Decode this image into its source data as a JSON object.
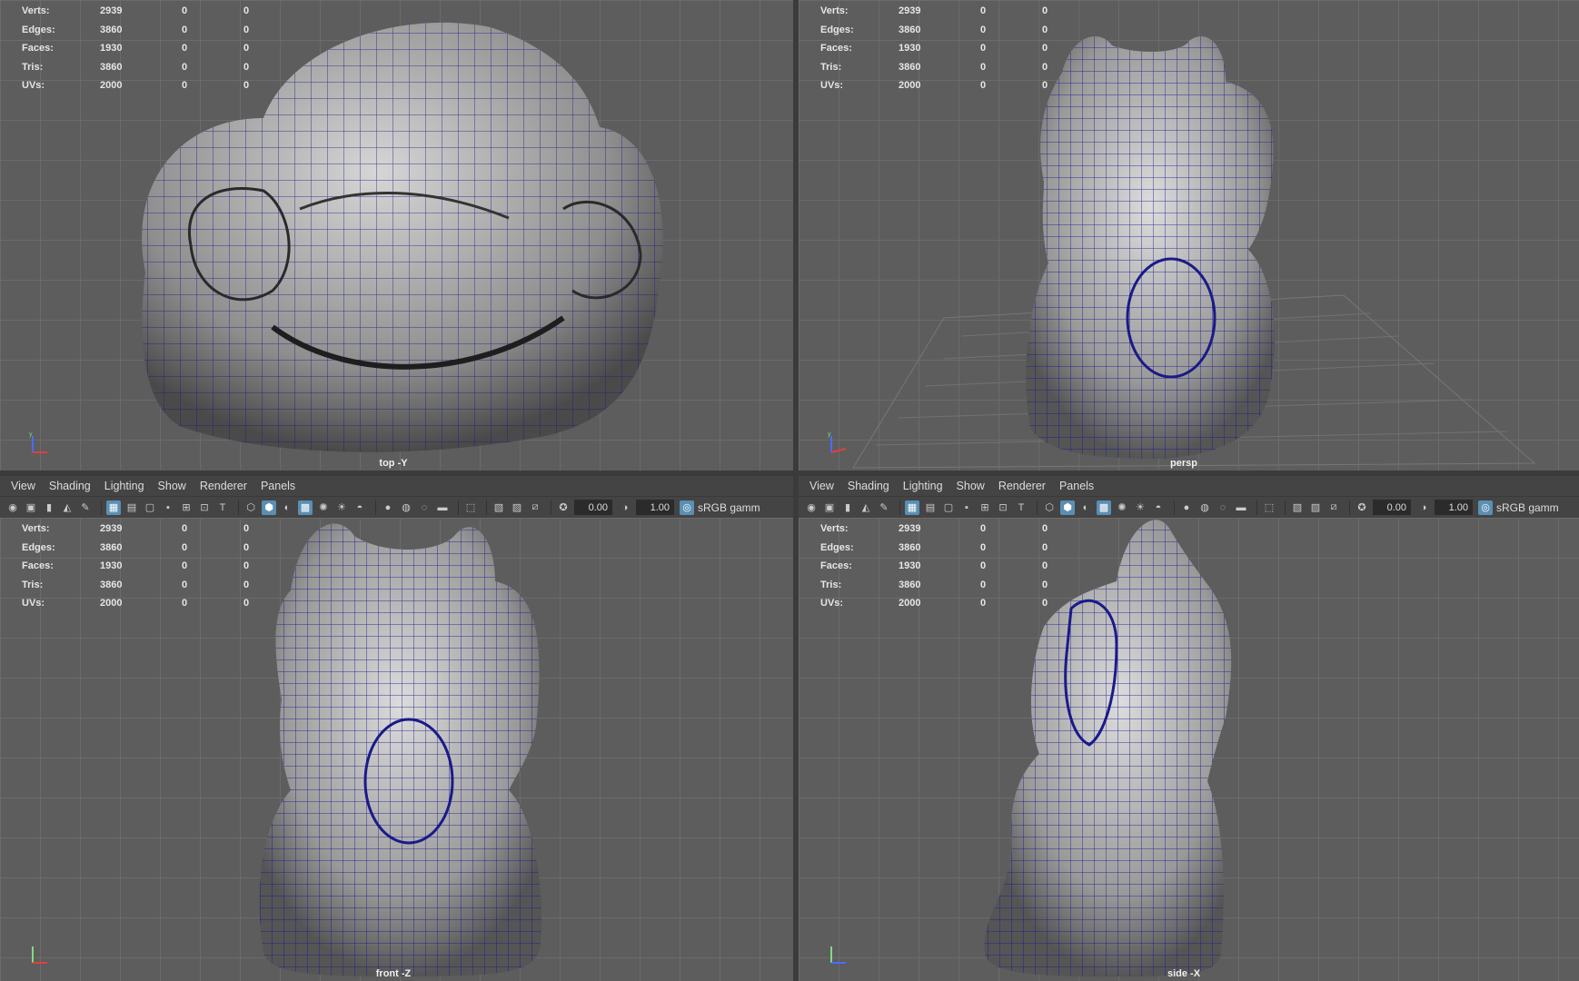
{
  "hud_labels": [
    "Verts:",
    "Edges:",
    "Faces:",
    "Tris:",
    "UVs:"
  ],
  "hud_totals": [
    "2939",
    "3860",
    "1930",
    "3860",
    "2000"
  ],
  "hud_col_a": [
    "0",
    "0",
    "0",
    "0",
    "0"
  ],
  "hud_col_b": [
    "0",
    "0",
    "0",
    "0",
    "0"
  ],
  "viewports": {
    "top": {
      "camera": "top -Y"
    },
    "persp": {
      "camera": "persp"
    },
    "front": {
      "camera": "front -Z"
    },
    "side": {
      "camera": "side -X"
    }
  },
  "panel_menu": {
    "view": "View",
    "shading": "Shading",
    "lighting": "Lighting",
    "show": "Show",
    "renderer": "Renderer",
    "panels": "Panels"
  },
  "toolbar": {
    "exposure": "0.00",
    "gamma": "1.00",
    "color_space": "sRGB gamm"
  },
  "colors": {
    "viewport_bg": "#5d5d5d",
    "grid": "#6b6b6b",
    "wireframe": "#1a1a8a",
    "mesh_shade": "#a8a8a8",
    "panel_bg": "#444444",
    "highlight": "#5a8fb3"
  },
  "icons": [
    "camera-icon",
    "grid-icon",
    "wireframe-icon",
    "smooth-shade-icon",
    "texture-icon",
    "light-icon",
    "xray-icon",
    "isolate-icon",
    "exposure-icon",
    "gamma-icon",
    "color-management-icon"
  ]
}
